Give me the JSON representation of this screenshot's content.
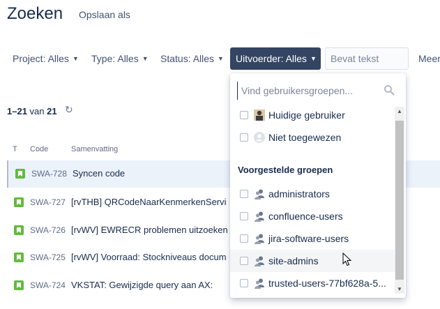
{
  "header": {
    "title": "Zoeken",
    "save_as": "Opslaan als"
  },
  "filters": {
    "project": "Project: Alles",
    "type": "Type: Alles",
    "status": "Status: Alles",
    "assignee": "Uitvoerder: Alles",
    "text_placeholder": "Bevat tekst",
    "more": "Meer"
  },
  "results": {
    "range": "1–21",
    "of_label": "van",
    "total": "21"
  },
  "columns": {
    "type": "T",
    "code": "Code",
    "summary": "Samenvatting"
  },
  "rows": [
    {
      "key": "SWA-728",
      "summary": "Syncen code"
    },
    {
      "key": "SWA-727",
      "summary": "[rvTHB] QRCodeNaarKenmerkenServi"
    },
    {
      "key": "SWA-726",
      "summary": "[rvWV] EWRECR problemen uitzoeken"
    },
    {
      "key": "SWA-725",
      "summary": "[rvWV] Voorraad: Stockniveaus docum"
    },
    {
      "key": "SWA-724",
      "summary": "VKSTAT: Gewijzigde query aan AX:"
    }
  ],
  "dropdown": {
    "search_placeholder": "Vind gebruikersgroepen...",
    "current_user": "Huidige gebruiker",
    "unassigned": "Niet toegewezen",
    "suggested_title": "Voorgestelde groepen",
    "groups": [
      "administrators",
      "confluence-users",
      "jira-software-users",
      "site-admins",
      "trusted-users-77bf628a-5..."
    ]
  },
  "colors": {
    "accent_dark": "#344563",
    "story_green": "#63ba3c",
    "text": "#172b4d"
  }
}
